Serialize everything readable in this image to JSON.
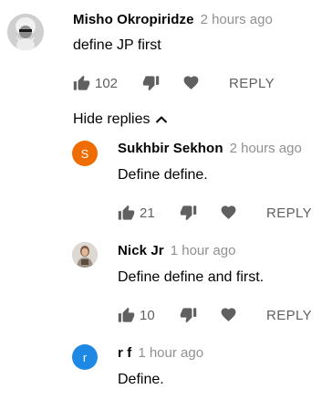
{
  "comments": [
    {
      "author": "Misho Okropiridze",
      "time": "2 hours ago",
      "text": "define JP first",
      "likes": "102",
      "reply_label": "REPLY",
      "avatar_icon": "bearded-man-avatar"
    }
  ],
  "hide_replies_label": "Hide replies",
  "replies": [
    {
      "author": "Sukhbir Sekhon",
      "time": "2 hours ago",
      "text": "Define define.",
      "likes": "21",
      "reply_label": "REPLY",
      "avatar_letter": "S",
      "avatar_color": "#ef6c00"
    },
    {
      "author": "Nick Jr",
      "time": "1 hour ago",
      "text": "Define define and first.",
      "likes": "10",
      "reply_label": "REPLY",
      "avatar_icon": "person-photo-avatar"
    },
    {
      "author": "r f",
      "time": "1 hour ago",
      "text": "Define.",
      "avatar_letter": "r",
      "avatar_color": "#1e88e5"
    }
  ],
  "colors": {
    "icon": "#606060",
    "meta": "#909090"
  }
}
